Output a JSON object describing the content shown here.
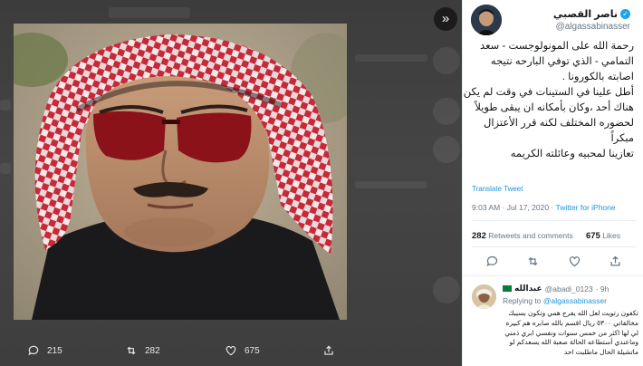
{
  "lightbox": {
    "collapse_icon": "double-chevron-right-icon",
    "actions": [
      {
        "icon": "reply-icon",
        "count": "215"
      },
      {
        "icon": "retweet-icon",
        "count": "282"
      },
      {
        "icon": "like-icon",
        "count": "675"
      },
      {
        "icon": "share-icon",
        "count": ""
      }
    ]
  },
  "tweet": {
    "author_name": "ناصر القصبي",
    "author_handle": "@algassabinasser",
    "text_lines": [
      "رحمة الله على المونولوجست - سعد",
      "التمامي - الذي توفي البارحه نتيجه",
      "اصابته بالكورونا .",
      "أطل علينا في الستينات في وقت لم يكن",
      "هناك أحد ،وكان بأمكانه ان يبقى طويلاً",
      "لحضوره المختلف  لكنه قرر الأعتزال",
      "مبكراً",
      "تعازينا لمحبيه وعائلته الكريمه"
    ],
    "translate_label": "Translate Tweet",
    "timestamp": "9:03 AM · Jul 17, 2020 · ",
    "source": "Twitter for iPhone",
    "retweets": "282",
    "retweets_label": "Retweets and comments",
    "likes": "675",
    "likes_label": "Likes"
  },
  "reply": {
    "name": "عبدالله",
    "handle": "@abadi_0123",
    "time": "· 9h",
    "replying_prefix": "Replying to ",
    "replying_to": "@algassabinasser",
    "text_lines": [
      "تكفون رتويت لعل الله يفرج همي وتكون بسببك",
      "مخالفاتي ٥٣٠٠ ريال اقسم بالله صابره هم كبيره",
      "لي لها اكثر من خمس سنوات ونفسي ابري ذمتي",
      "وماعندي أستطاعه الحالة صعبة الله يسعدكم لو",
      "ماتشيلة الحال ماطلبت احد"
    ]
  },
  "colors": {
    "accent": "#1da1f2",
    "text": "#14171a",
    "muted": "#657786"
  }
}
